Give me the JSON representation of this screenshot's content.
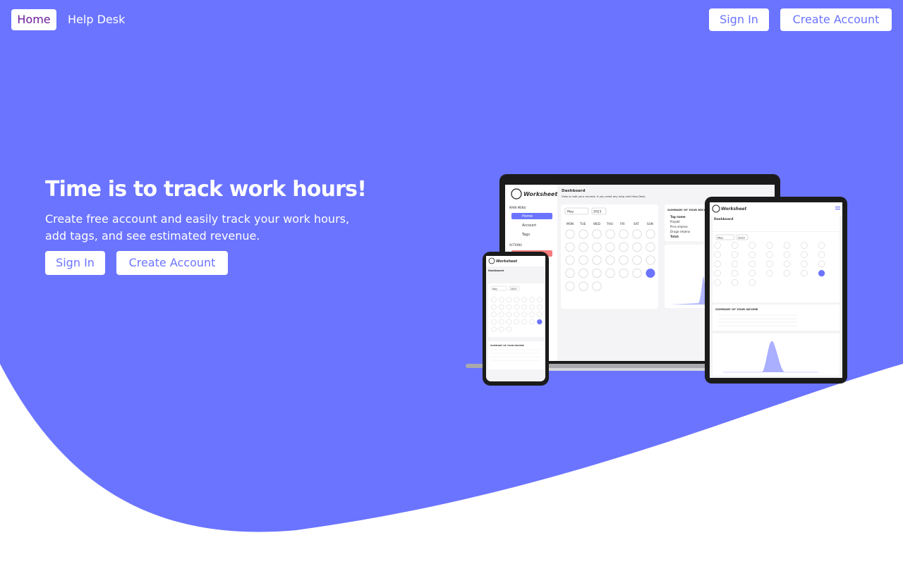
{
  "nav": {
    "home": "Home",
    "help_desk": "Help Desk",
    "sign_in": "Sign In",
    "create_account": "Create Account"
  },
  "hero": {
    "title": "Time is to track work hours!",
    "subtitle": "Create free account and easily track your work hours, add tags, and see estimated revenue.",
    "sign_in": "Sign In",
    "create_account": "Create Account"
  },
  "mockup": {
    "brand": "Worksheet",
    "dashboard_title": "Dashboard",
    "dashboard_sub": "View or edit your records. If you need any help visit Help Desk",
    "menu_label": "MAIN MENU",
    "menu_items": [
      "Home",
      "Account",
      "Tags"
    ],
    "actions_label": "ACTIONS",
    "month": "May",
    "year": "2023",
    "weekdays": [
      "MON",
      "TUE",
      "WED",
      "THU",
      "FRI",
      "SAT",
      "SUN"
    ],
    "summary_title": "SUMMARY OF YOUR RECORDS",
    "summary_rows": [
      "Tag name",
      "Projekt",
      "Prva smjena",
      "Druga smjena",
      "Total:"
    ],
    "income_title": "SUMMARY OF YOUR INCOME"
  },
  "colors": {
    "primary": "#6b74ff",
    "home_text": "#6a1b9a",
    "white": "#ffffff"
  }
}
